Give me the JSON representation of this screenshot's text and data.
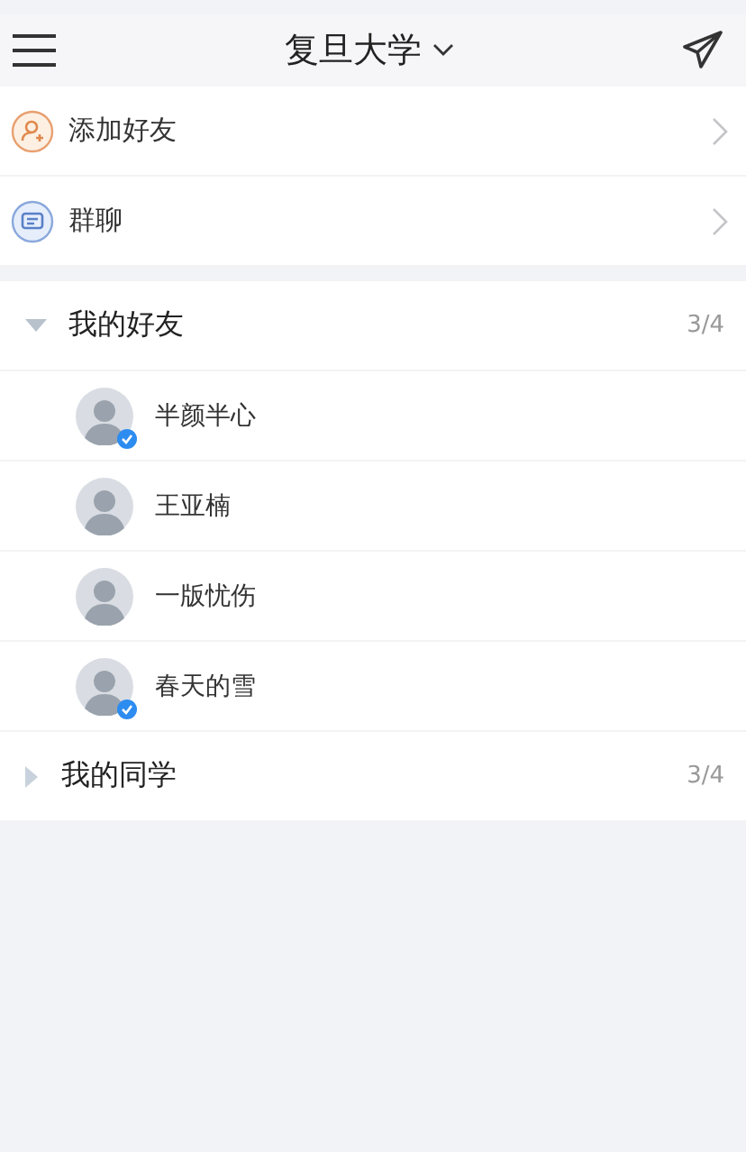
{
  "header": {
    "title": "复旦大学"
  },
  "actions": [
    {
      "kind": "add-friend",
      "label": "添加好友"
    },
    {
      "kind": "group-chat",
      "label": "群聊"
    }
  ],
  "groups": [
    {
      "name": "我的好友",
      "count": "3/4",
      "expanded": true,
      "friends": [
        {
          "name": "半颜半心",
          "verified": true
        },
        {
          "name": "王亚楠",
          "verified": false
        },
        {
          "name": "一版忧伤",
          "verified": false
        },
        {
          "name": "春天的雪",
          "verified": true
        }
      ]
    },
    {
      "name": "我的同学",
      "count": "3/4",
      "expanded": false
    }
  ]
}
